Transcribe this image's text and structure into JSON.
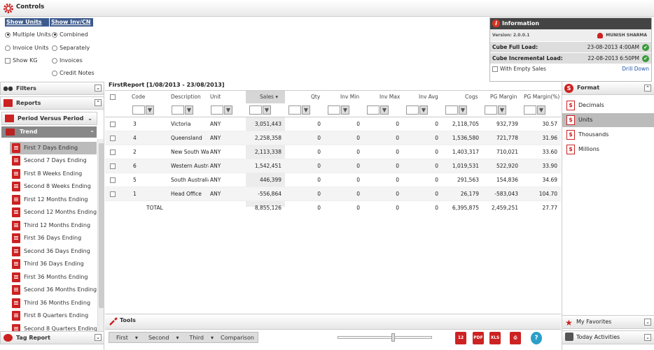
{
  "app": {
    "title": "Controls"
  },
  "options": {
    "units_header": "Show Units As",
    "inv_header": "Show Inv/CN As",
    "units": [
      {
        "label": "Multiple Units",
        "selected": true
      },
      {
        "label": "Invoice Units",
        "selected": false
      }
    ],
    "show_kg": "Show KG",
    "inv": [
      {
        "label": "Combined",
        "selected": true
      },
      {
        "label": "Separately",
        "selected": false
      },
      {
        "label": "Invoices",
        "selected": false
      },
      {
        "label": "Credit Notes",
        "selected": false
      }
    ]
  },
  "info": {
    "title": "Information",
    "version": "Version: 2.0.0.1",
    "user": "MUNISH SHARMA",
    "full_load_label": "Cube Full Load:",
    "full_load_value": "23-08-2013 4:00AM",
    "inc_load_label": "Cube Incremental Load:",
    "inc_load_value": "22-08-2013 6:50PM",
    "empty_sales": "With Empty Sales",
    "drill_down": "Drill Down"
  },
  "left": {
    "filters": "Filters",
    "reports": "Reports",
    "period": "Period Versus Period",
    "trend": "Trend",
    "items": [
      "First 7 Days Ending",
      "Second 7 Days Ending",
      "First 8 Weeks Ending",
      "Second 8 Weeks Ending",
      "First 12 Months Ending",
      "Second 12 Months Ending",
      "Third 12 Months Ending",
      "First 36 Days Ending",
      "Second 36 Days Ending",
      "Third 36 Days Ending",
      "First 36 Months Ending",
      "Second 36 Months Ending",
      "Third 36 Months Ending",
      "First 8 Quarters Ending",
      "Second 8 Quarters Ending"
    ],
    "tag_report": "Tag Report"
  },
  "report": {
    "title": "FirstReport [1/08/2013 - 23/08/2013]",
    "columns": [
      "Code",
      "Description",
      "Unit",
      "Sales",
      "Qty",
      "Inv Min",
      "Inv Max",
      "Inv Avg",
      "Cogs",
      "PG Margin",
      "PG Margin(%)"
    ],
    "rows": [
      [
        "3",
        "Victoria",
        "ANY",
        "3,051,443",
        "0",
        "0",
        "0",
        "0",
        "2,118,705",
        "932,739",
        "30.57"
      ],
      [
        "4",
        "Queensland",
        "ANY",
        "2,258,358",
        "0",
        "0",
        "0",
        "0",
        "1,536,580",
        "721,778",
        "31.96"
      ],
      [
        "2",
        "New South Wa",
        "ANY",
        "2,113,338",
        "0",
        "0",
        "0",
        "0",
        "1,403,317",
        "710,021",
        "33.60"
      ],
      [
        "6",
        "Western Austra",
        "ANY",
        "1,542,451",
        "0",
        "0",
        "0",
        "0",
        "1,019,531",
        "522,920",
        "33.90"
      ],
      [
        "5",
        "South Australia",
        "ANY",
        "446,399",
        "0",
        "0",
        "0",
        "0",
        "291,563",
        "154,836",
        "34.69"
      ],
      [
        "1",
        "Head Office",
        "ANY",
        "-556,864",
        "0",
        "0",
        "0",
        "0",
        "26,179",
        "-583,043",
        "104.70"
      ]
    ],
    "total": [
      "TOTAL",
      "8,855,126",
      "0",
      "0",
      "0",
      "0",
      "6,395,875",
      "2,459,251",
      "27.77"
    ]
  },
  "tools": {
    "title": "Tools",
    "nav": [
      "First",
      "Second",
      "Third",
      "Comparison"
    ],
    "calendar_day": "12",
    "pdf": "PDF",
    "xls": "XLS",
    "help": "?"
  },
  "right": {
    "format": "Format",
    "items": [
      "Decimals",
      "Units",
      "Thousands",
      "Millions"
    ],
    "selected": "Units",
    "favorites": "My Favorites",
    "today": "Today Activities"
  },
  "colors": {
    "accent": "#cc2222",
    "header_blue": "#3c5a8c",
    "ok_green": "#3a9a3a"
  }
}
